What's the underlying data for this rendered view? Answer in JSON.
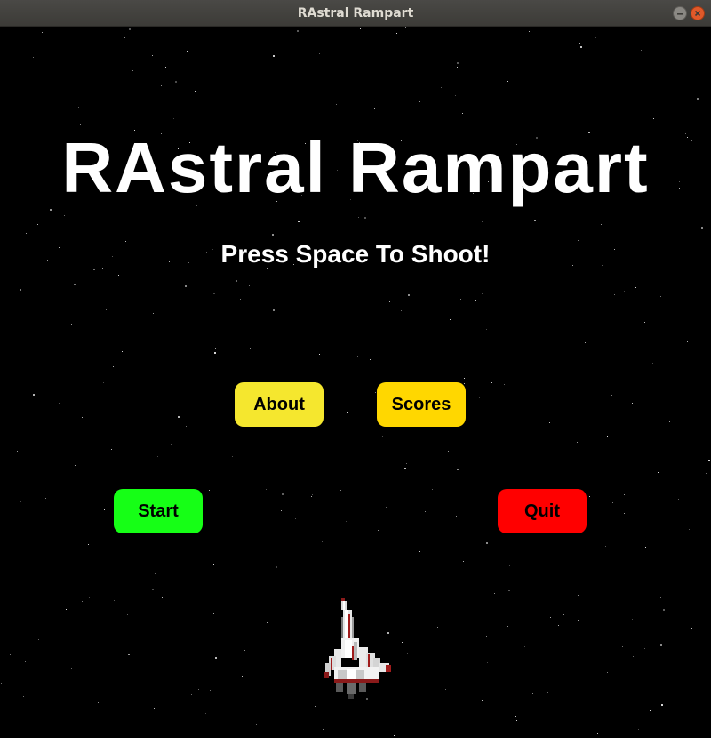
{
  "window": {
    "title": "RAstral Rampart"
  },
  "game": {
    "title": "RAstral Rampart",
    "instruction": "Press Space To Shoot!"
  },
  "menu": {
    "about_label": "About",
    "scores_label": "Scores",
    "start_label": "Start",
    "quit_label": "Quit"
  },
  "colors": {
    "background": "#000000",
    "about_button": "#f5e72e",
    "scores_button": "#ffd700",
    "start_button": "#16ff16",
    "quit_button": "#ff0000"
  },
  "icons": {
    "player": "spaceship-icon",
    "minimize": "minimize-icon",
    "close": "close-icon"
  }
}
